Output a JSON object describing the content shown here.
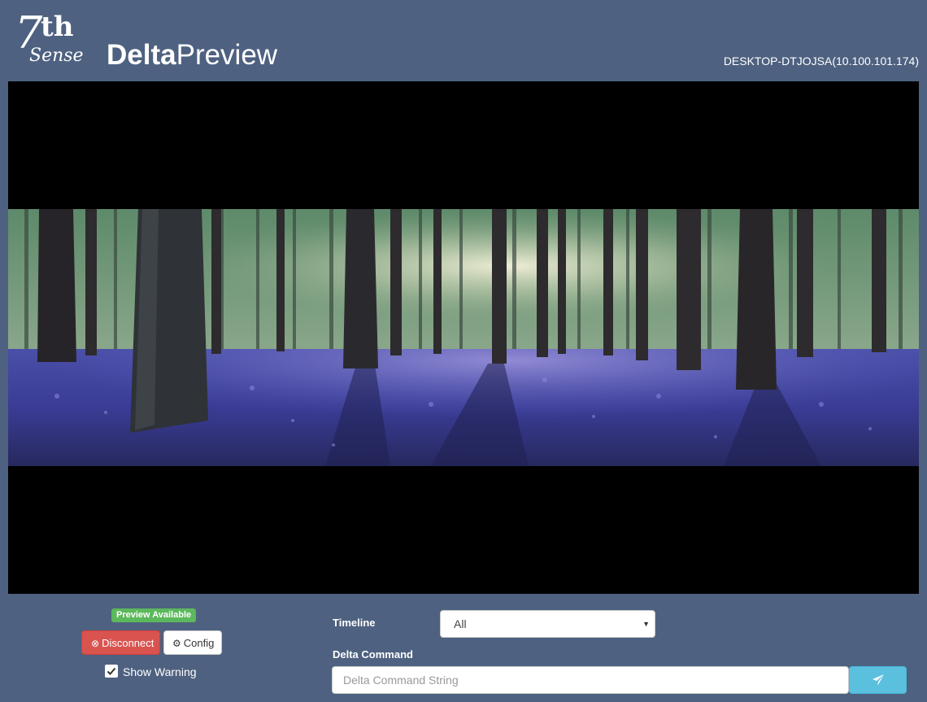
{
  "header": {
    "logo": {
      "seven": "7",
      "th": "th",
      "sense": "Sense"
    },
    "title_bold": "Delta",
    "title_rest": "Preview",
    "host": "DESKTOP-DTJOJSA(10.100.101.174)"
  },
  "preview": {
    "description_icon": "forest-image"
  },
  "controls": {
    "status_badge": "Preview Available",
    "disconnect_label": "Disconnect",
    "disconnect_icon": "times-circle-icon",
    "config_label": "Config",
    "config_icon": "gear-icon",
    "show_warning_label": "Show Warning",
    "show_warning_checked": true
  },
  "command": {
    "timeline_label": "Timeline",
    "timeline_value": "All",
    "delta_command_label": "Delta Command",
    "delta_command_placeholder": "Delta Command String",
    "delta_command_value": "",
    "send_icon": "paper-plane-icon"
  },
  "colors": {
    "background": "#4e6180",
    "success": "#5cb85c",
    "danger": "#d9534f",
    "info": "#5bc0de"
  }
}
